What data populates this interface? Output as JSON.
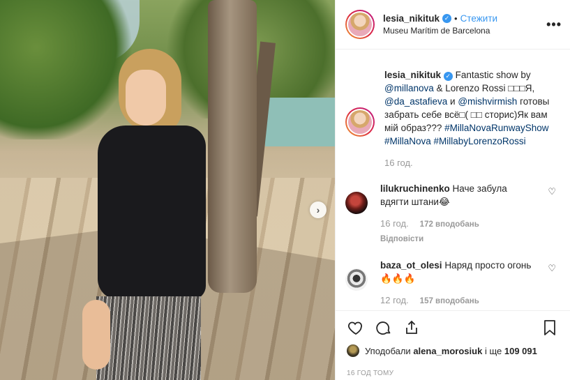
{
  "header": {
    "username": "lesia_nikituk",
    "dot": "•",
    "follow_label": "Стежити",
    "location": "Museu Marítim de Barcelona",
    "more": "•••"
  },
  "caption": {
    "username": "lesia_nikituk",
    "text_1": "Fantastic show by",
    "mention_1": "@millanova",
    "text_2": "& Lorenzo Rossi □□□Я,",
    "mention_2": "@da_astafieva",
    "text_3": "и",
    "mention_3": "@mishvirmish",
    "text_4": "готовы забрать себе всё□( □□ сторис)Як вам мій образ???",
    "hashtag_1": "#MillaNovaRunwayShow",
    "hashtag_2": "#MillaNova",
    "hashtag_3": "#MillabyLorenzoRossi",
    "time": "16 год."
  },
  "comments": [
    {
      "username": "lilukruchinenko",
      "text": "Наче забула вдягти штани😂",
      "time": "16 год.",
      "likes": "172 вподобань",
      "reply": "Відповісти"
    },
    {
      "username": "baza_ot_olesi",
      "text": "Наряд просто огонь 🔥🔥🔥",
      "time": "12 год.",
      "likes": "157 вподобань"
    }
  ],
  "likes": {
    "prefix": "Уподобали",
    "user": "alena_morosiuk",
    "middle": "і ще",
    "count": "109 091"
  },
  "date": "16 ГОД ТОМУ"
}
